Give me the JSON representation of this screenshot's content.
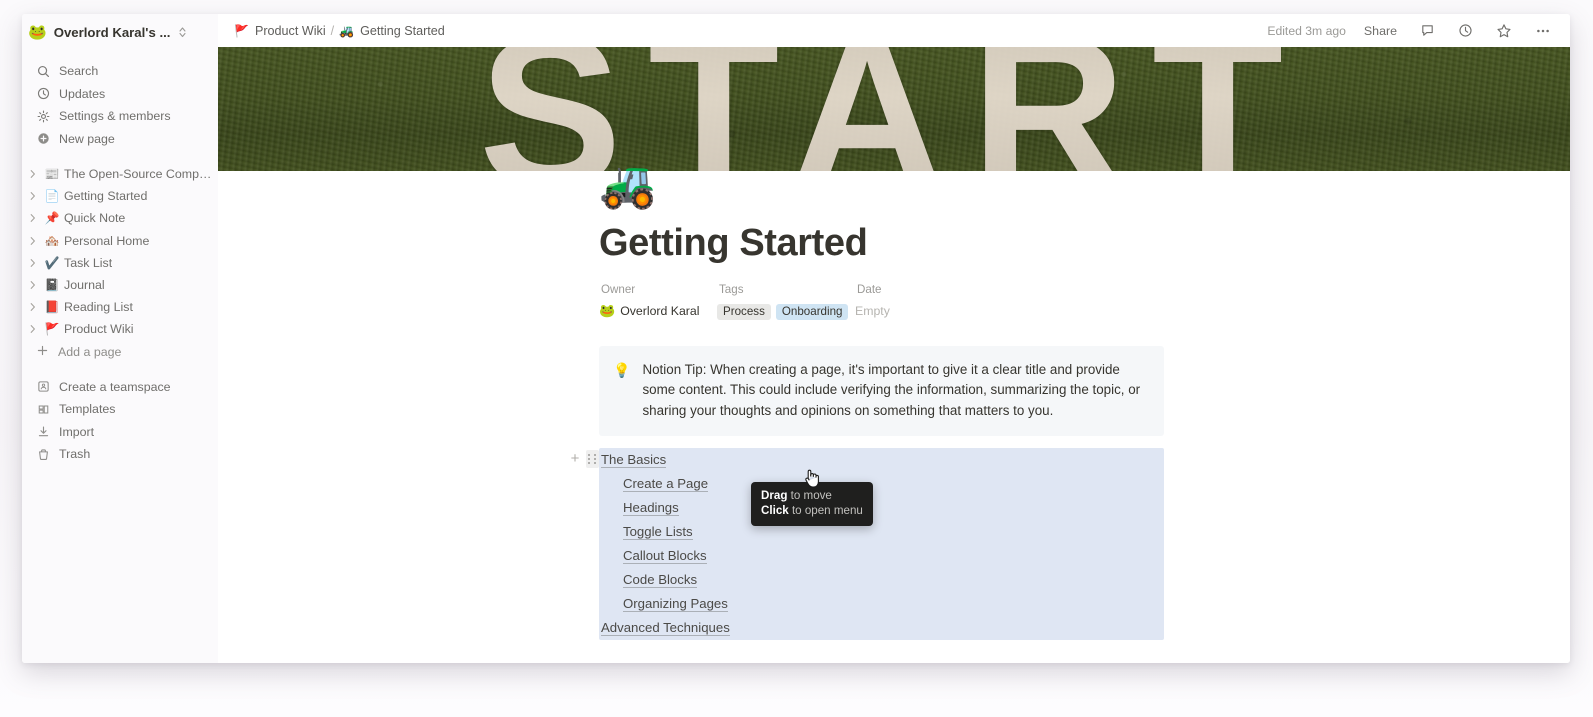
{
  "workspace": {
    "emoji": "🐸",
    "name": "Overlord Karal's ...",
    "switcher_icon": "chevron-updown-icon"
  },
  "sidebar": {
    "actions": [
      {
        "label": "Search",
        "icon": "search-icon"
      },
      {
        "label": "Updates",
        "icon": "clock-icon"
      },
      {
        "label": "Settings & members",
        "icon": "gear-icon"
      },
      {
        "label": "New page",
        "icon": "plus-circle-icon"
      }
    ],
    "pages": [
      {
        "label": "The Open-Source Compu...",
        "emoji": "📰"
      },
      {
        "label": "Getting Started",
        "emoji": "📄"
      },
      {
        "label": "Quick Note",
        "emoji": "📌"
      },
      {
        "label": "Personal Home",
        "emoji": "🏘️"
      },
      {
        "label": "Task List",
        "emoji": "✔️"
      },
      {
        "label": "Journal",
        "emoji": "📓"
      },
      {
        "label": "Reading List",
        "emoji": "📕"
      },
      {
        "label": "Product Wiki",
        "emoji": "🚩"
      }
    ],
    "add_page_label": "Add a page",
    "footer": [
      {
        "label": "Create a teamspace",
        "icon": "teamspace-icon"
      },
      {
        "label": "Templates",
        "icon": "templates-icon"
      },
      {
        "label": "Import",
        "icon": "import-icon"
      },
      {
        "label": "Trash",
        "icon": "trash-icon"
      }
    ]
  },
  "topbar": {
    "breadcrumb": [
      {
        "label": "Product Wiki",
        "emoji": "🚩"
      },
      {
        "label": "Getting Started",
        "emoji": "🚜"
      }
    ],
    "separator": "/",
    "edited_status": "Edited 3m ago",
    "share_label": "Share",
    "icons": [
      {
        "name": "comment-icon"
      },
      {
        "name": "history-clock-icon"
      },
      {
        "name": "star-icon"
      },
      {
        "name": "more-options-icon"
      }
    ]
  },
  "page": {
    "cover_text": "START",
    "icon_emoji": "🚜",
    "title": "Getting Started",
    "properties": {
      "owner": {
        "label": "Owner",
        "value": "Overlord Karal",
        "avatar_emoji": "🐸"
      },
      "tags": {
        "label": "Tags",
        "values": [
          {
            "text": "Process",
            "color": "#e8e8e6"
          },
          {
            "text": "Onboarding",
            "color": "#cfe4f3"
          }
        ]
      },
      "date": {
        "label": "Date",
        "value": "Empty"
      }
    },
    "callout": {
      "emoji": "💡",
      "text": "Notion Tip: When creating a page, it's important to give it a clear title and provide some content. This could include verifying the information, summarizing the topic, or sharing your thoughts and opinions on something that matters to you."
    },
    "list": [
      {
        "text": "The Basics",
        "indent": false
      },
      {
        "text": "Create a Page",
        "indent": true
      },
      {
        "text": "Headings",
        "indent": true
      },
      {
        "text": "Toggle Lists",
        "indent": true
      },
      {
        "text": "Callout Blocks",
        "indent": true
      },
      {
        "text": "Code Blocks",
        "indent": true
      },
      {
        "text": "Organizing Pages",
        "indent": true
      },
      {
        "text": "Advanced Techniques",
        "indent": false
      }
    ],
    "selection_color": "#dfe6f3"
  },
  "tooltip": {
    "line1_bold": "Drag",
    "line1_rest": " to move",
    "line2_bold": "Click",
    "line2_rest": " to open menu"
  }
}
